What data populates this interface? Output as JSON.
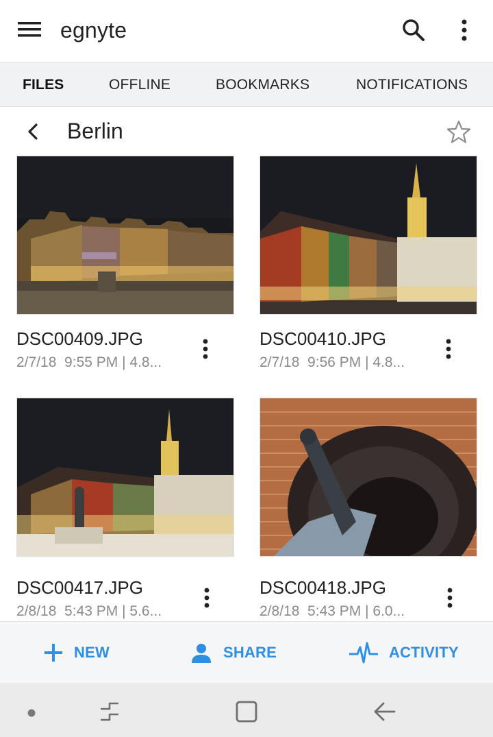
{
  "app": {
    "brand": "egnyte"
  },
  "tabs": [
    {
      "label": "FILES",
      "active": true
    },
    {
      "label": "OFFLINE",
      "active": false
    },
    {
      "label": "BOOKMARKS",
      "active": false
    },
    {
      "label": "NOTIFICATIONS",
      "active": false
    }
  ],
  "folder": {
    "title": "Berlin"
  },
  "files": [
    {
      "name": "DSC00409.JPG",
      "meta": "2/7/18  9:55 PM | 4.8..."
    },
    {
      "name": "DSC00410.JPG",
      "meta": "2/7/18  9:56 PM | 4.8..."
    },
    {
      "name": "DSC00417.JPG",
      "meta": "2/8/18  5:43 PM | 5.6..."
    },
    {
      "name": "DSC00418.JPG",
      "meta": "2/8/18  5:43 PM | 6.0..."
    }
  ],
  "actions": {
    "new": "NEW",
    "share": "SHARE",
    "activity": "ACTIVITY"
  },
  "colors": {
    "accent": "#2e8fe5",
    "tab_bar": "#f1f2f3",
    "meta_text": "#8a8a8a"
  },
  "icons": {
    "menu": "hamburger-icon",
    "search": "search-icon",
    "more": "more-vert-icon",
    "back": "arrow-back-icon",
    "star": "star-outline-icon",
    "new": "plus-icon",
    "share": "person-icon",
    "activity": "pulse-icon"
  }
}
